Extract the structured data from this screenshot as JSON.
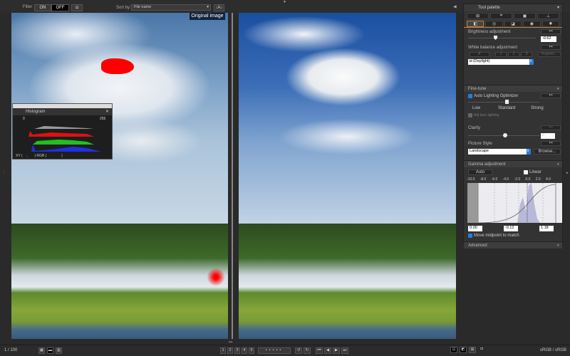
{
  "toolbar": {
    "filter_label": "Filter",
    "filter_on": "ON",
    "filter_off": "OFF",
    "sort_label": "Sort by:",
    "sort_value": "File name",
    "sort_order": "↓A↓"
  },
  "viewer": {
    "original_label": "Original image"
  },
  "histogram": {
    "title": "Histogram",
    "min": "0",
    "max": "255",
    "xy_label": "XY (",
    "xy_sep": ",",
    "xy_close": ")",
    "rgb_label": "RGB (",
    "rgb_close": ")",
    "colors": {
      "luma": "#9a9a9a",
      "red": "#e01010",
      "green": "#20c020",
      "blue": "#2030e0"
    }
  },
  "palette": {
    "title": "Tool palette",
    "brightness": {
      "label": "Brightness adjustment",
      "value": "-0.62",
      "level": 0.4
    },
    "white_balance": {
      "label": "White balance adjustment",
      "presets": [
        "1",
        "2",
        "3"
      ],
      "register": "Register...",
      "value": "(Daylight)"
    },
    "fine_tune": {
      "label": "Fine-tune",
      "alo_label": "Auto Lighting Optimizer",
      "alo_checked": true,
      "levels": [
        "Low",
        "Standard",
        "Strong"
      ],
      "face_label": "Adj face lighting",
      "clarity_label": "Clarity",
      "clarity_value": "0",
      "picture_style_label": "Picture Style",
      "picture_style_value": "Landscape",
      "browse": "Browse..."
    },
    "gamma": {
      "label": "Gamma adjustment",
      "auto": "Auto",
      "linear": "Linear",
      "ticks": [
        "-10.0",
        "-8.0",
        "-6.0",
        "-4.0",
        "-2.0",
        "0.0",
        "2.0",
        "4.0"
      ],
      "black": "0.00",
      "mid": "-0.12",
      "white": "1.18",
      "move_midpoint": "Move midpoint to match"
    },
    "advanced": {
      "label": "Advanced"
    }
  },
  "status": {
    "count": "1 / 100",
    "ratings": [
      "1",
      "2",
      "3",
      "4",
      "5"
    ],
    "color_space": "sRGB / sRGB"
  },
  "accent": "#2a7be0"
}
